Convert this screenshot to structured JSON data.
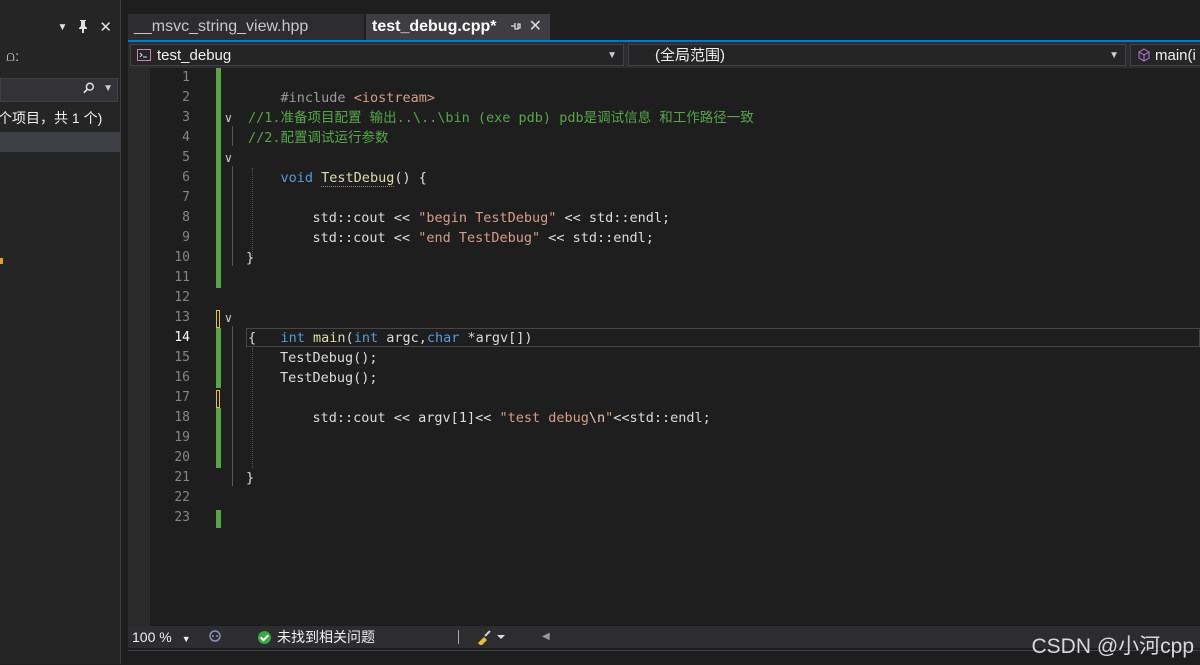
{
  "left_panel": {
    "title_dropdown": "▼",
    "pin": "🖈",
    "close": "✕",
    "tool_glyph": "⩍:",
    "search_placeholder": "",
    "result_text": "个项目，共 1 个)"
  },
  "tabs": [
    {
      "label": "__msvc_string_view.hpp",
      "active": false
    },
    {
      "label": "test_debug.cpp*",
      "active": true,
      "pin": "⊣",
      "close": "✕"
    }
  ],
  "navbar": {
    "project": "test_debug",
    "scope": "(全局范围)",
    "function": "main(i"
  },
  "editor": {
    "line_numbers": [
      "1",
      "2",
      "3",
      "4",
      "5",
      "6",
      "7",
      "8",
      "9",
      "10",
      "11",
      "12",
      "13",
      "14",
      "15",
      "16",
      "17",
      "18",
      "19",
      "20",
      "21",
      "22",
      "23"
    ],
    "current_line": "14",
    "code": {
      "l1_pp": "#include",
      "l1_inc": "<iostream>",
      "l3": "//1.准备项目配置 输出..\\..\\bin (exe pdb) pdb是调试信息 和工作路径一致",
      "l4": "//2.配置调试运行参数",
      "l5_kw": "void",
      "l5_fn": "TestDebug",
      "l5_rest": "() {",
      "l7_a": "std::cout << ",
      "l7_str": "\"begin TestDebug\"",
      "l7_b": " << std::endl;",
      "l8_a": "std::cout << ",
      "l8_str": "\"end TestDebug\"",
      "l8_b": " << std::endl;",
      "l10": "}",
      "l13_kw1": "int",
      "l13_fn": " main",
      "l13_p1": "(",
      "l13_kw2": "int",
      "l13_p2": " argc,",
      "l13_kw3": "char",
      "l13_p3": " *argv[])",
      "l14": "{",
      "l15": "TestDebug();",
      "l16": "TestDebug();",
      "l17_a": "std::cout << argv[1]<< ",
      "l17_str": "\"test debug",
      "l17_esc": "\\n",
      "l17_str2": "\"",
      "l17_b": "<<std::endl;",
      "l21": "}"
    }
  },
  "statusbar": {
    "zoom": "100 %",
    "issues": "未找到相关问题"
  },
  "watermark": "CSDN @小河cpp"
}
